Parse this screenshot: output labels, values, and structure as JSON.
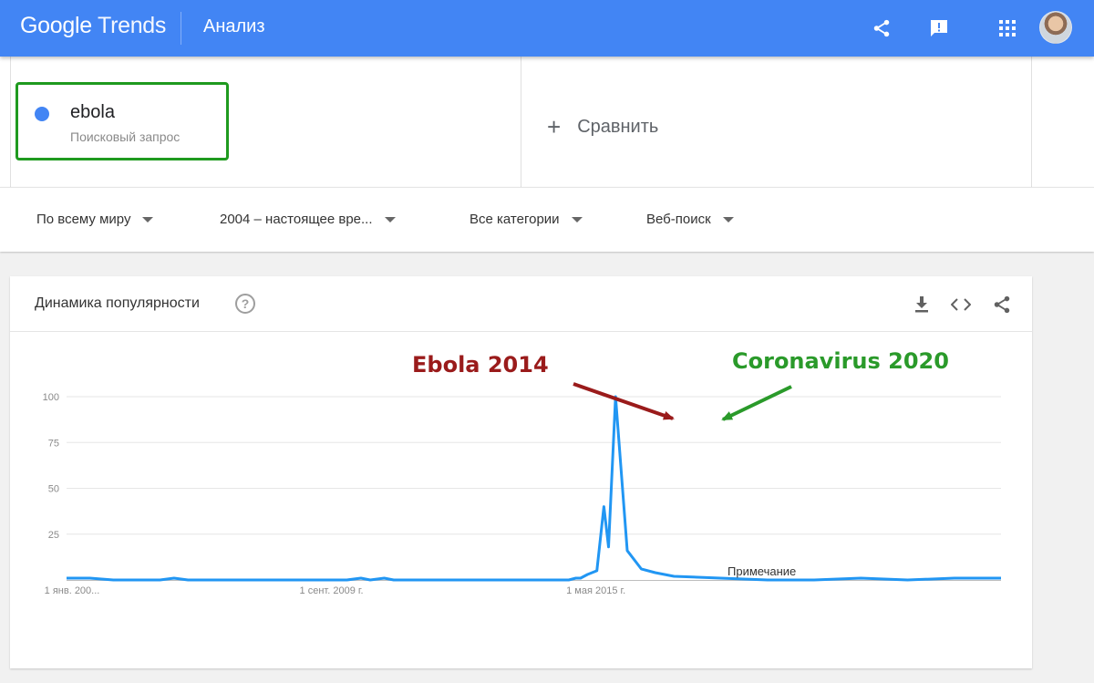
{
  "header": {
    "logo_google": "Google",
    "logo_trends": "Trends",
    "page_title": "Анализ"
  },
  "icons": [
    "share-icon",
    "feedback-icon",
    "apps-grid-icon",
    "avatar"
  ],
  "term": {
    "name": "ebola",
    "type": "Поисковый запрос",
    "color": "#4285f4"
  },
  "compare": {
    "label": "Сравнить"
  },
  "filters": {
    "region": "По всему миру",
    "period": "2004 – настоящее вре...",
    "category": "Все категории",
    "search_type": "Веб-поиск"
  },
  "card": {
    "title": "Динамика популярности",
    "help": "?"
  },
  "annotations": {
    "ebola": "Ebola 2014",
    "corona": "Coronavirus 2020",
    "note": "Примечание"
  },
  "chart_data": {
    "type": "line",
    "series": [
      {
        "color": "#4285f4",
        "x": [
          2004.0,
          2004.2,
          2004.5,
          2005.0,
          2005.5,
          2006.0,
          2006.3,
          2006.6,
          2007.0,
          2008.0,
          2009.0,
          2010.0,
          2010.3,
          2010.5,
          2010.8,
          2011.0,
          2012.0,
          2013.0,
          2014.0,
          2014.5,
          2014.75,
          2014.9,
          2015.0,
          2015.15,
          2015.35,
          2015.5,
          2015.6,
          2015.75,
          2016.0,
          2016.3,
          2016.6,
          2017.0,
          2018.0,
          2019.0,
          2019.5,
          2020.0,
          2021.0,
          2022.0,
          2023.0,
          2024.0
        ],
        "y": [
          1,
          1,
          1,
          0,
          0,
          0,
          1,
          0,
          0,
          0,
          0,
          0,
          1,
          0,
          1,
          0,
          0,
          0,
          0,
          0,
          0,
          1,
          1,
          3,
          5,
          40,
          18,
          100,
          16,
          6,
          4,
          2,
          1,
          0,
          0,
          0,
          1,
          0,
          1,
          1
        ]
      }
    ],
    "x_ticks": [
      "1 янв. 200...",
      "1 сент. 2009 г.",
      "1 мая 2015 г."
    ],
    "y_ticks": [
      "100",
      "75",
      "50",
      "25"
    ],
    "ylim": [
      0,
      100
    ]
  }
}
